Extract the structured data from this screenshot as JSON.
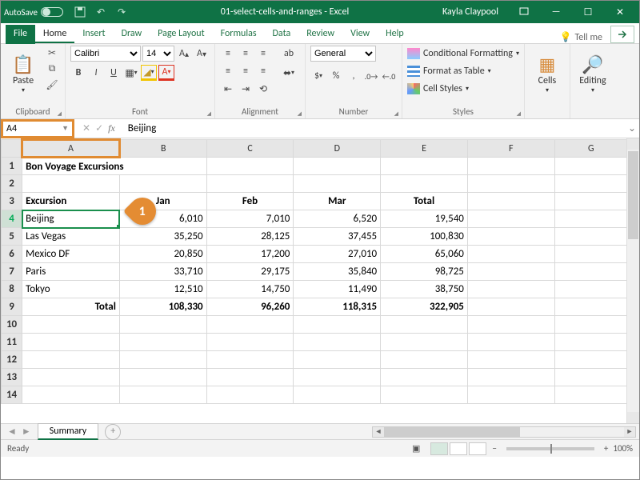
{
  "titlebar": {
    "autosave_label": "AutoSave",
    "autosave_state": "Off",
    "doc_title": "01-select-cells-and-ranges - Excel",
    "user": "Kayla Claypool"
  },
  "ribbon_tabs": [
    "File",
    "Home",
    "Insert",
    "Draw",
    "Page Layout",
    "Formulas",
    "Data",
    "Review",
    "View",
    "Help"
  ],
  "tell_me_placeholder": "Tell me",
  "ribbon": {
    "clipboard": {
      "paste": "Paste",
      "label": "Clipboard"
    },
    "font": {
      "name": "Calibri",
      "size": "14",
      "label": "Font"
    },
    "alignment": {
      "label": "Alignment"
    },
    "number": {
      "format": "General",
      "label": "Number"
    },
    "styles": {
      "cond": "Conditional Formatting",
      "table": "Format as Table",
      "cell": "Cell Styles",
      "label": "Styles"
    },
    "cells": {
      "btn": "Cells",
      "label": ""
    },
    "editing": {
      "btn": "Editing",
      "label": ""
    }
  },
  "name_box": "A4",
  "formula_bar": "Beijing",
  "columns": [
    "A",
    "B",
    "C",
    "D",
    "E",
    "F",
    "G"
  ],
  "rows": {
    "title": "Bon Voyage Excursions",
    "headers": [
      "Excursion",
      "Jan",
      "Feb",
      "Mar",
      "Total"
    ],
    "data": [
      {
        "name": "Beijing",
        "jan": "6,010",
        "feb": "7,010",
        "mar": "6,520",
        "total": "19,540"
      },
      {
        "name": "Las Vegas",
        "jan": "35,250",
        "feb": "28,125",
        "mar": "37,455",
        "total": "100,830"
      },
      {
        "name": "Mexico DF",
        "jan": "20,850",
        "feb": "17,200",
        "mar": "27,010",
        "total": "65,060"
      },
      {
        "name": "Paris",
        "jan": "33,710",
        "feb": "29,175",
        "mar": "35,840",
        "total": "98,725"
      },
      {
        "name": "Tokyo",
        "jan": "12,510",
        "feb": "14,750",
        "mar": "11,490",
        "total": "38,750"
      }
    ],
    "total_row": {
      "label": "Total",
      "jan": "108,330",
      "feb": "96,260",
      "mar": "118,315",
      "total": "322,905"
    }
  },
  "marker": "1",
  "sheet_tab": "Summary",
  "status": {
    "ready": "Ready",
    "zoom": "100%"
  },
  "chart_data": {
    "type": "table",
    "title": "Bon Voyage Excursions",
    "columns": [
      "Excursion",
      "Jan",
      "Feb",
      "Mar",
      "Total"
    ],
    "rows": [
      [
        "Beijing",
        6010,
        7010,
        6520,
        19540
      ],
      [
        "Las Vegas",
        35250,
        28125,
        37455,
        100830
      ],
      [
        "Mexico DF",
        20850,
        17200,
        27010,
        65060
      ],
      [
        "Paris",
        33710,
        29175,
        35840,
        98725
      ],
      [
        "Tokyo",
        12510,
        14750,
        11490,
        38750
      ],
      [
        "Total",
        108330,
        96260,
        118315,
        322905
      ]
    ]
  }
}
